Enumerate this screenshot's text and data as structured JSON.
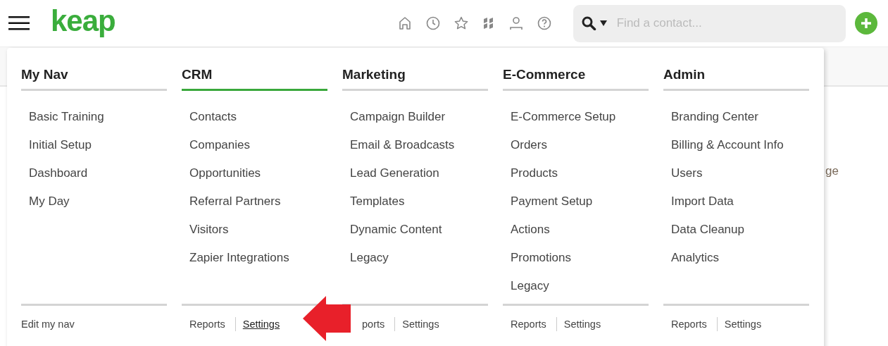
{
  "header": {
    "logo": "keap",
    "search": {
      "placeholder": "Find a contact..."
    }
  },
  "menu": {
    "columns": [
      {
        "title": "My Nav",
        "selected": false,
        "items": [
          "Basic Training",
          "Initial Setup",
          "Dashboard",
          "My Day"
        ],
        "footer": [
          {
            "label": "Edit my nav",
            "underlined": false
          }
        ]
      },
      {
        "title": "CRM",
        "selected": true,
        "items": [
          "Contacts",
          "Companies",
          "Opportunities",
          "Referral Partners",
          "Visitors",
          "Zapier Integrations"
        ],
        "footer": [
          {
            "label": "Reports",
            "underlined": false
          },
          {
            "label": "Settings",
            "underlined": true
          }
        ]
      },
      {
        "title": "Marketing",
        "selected": false,
        "items": [
          "Campaign Builder",
          "Email & Broadcasts",
          "Lead Generation",
          "Templates",
          "Dynamic Content",
          "Legacy"
        ],
        "footer": [
          {
            "label": "ports",
            "underlined": false
          },
          {
            "label": "Settings",
            "underlined": false
          }
        ]
      },
      {
        "title": "E-Commerce",
        "selected": false,
        "items": [
          "E-Commerce Setup",
          "Orders",
          "Products",
          "Payment Setup",
          "Actions",
          "Promotions",
          "Legacy"
        ],
        "footer": [
          {
            "label": "Reports",
            "underlined": false
          },
          {
            "label": "Settings",
            "underlined": false
          }
        ]
      },
      {
        "title": "Admin",
        "selected": false,
        "items": [
          "Branding Center",
          "Billing & Account Info",
          "Users",
          "Import Data",
          "Data Cleanup",
          "Analytics"
        ],
        "footer": [
          {
            "label": "Reports",
            "underlined": false
          },
          {
            "label": "Settings",
            "underlined": false
          }
        ]
      }
    ]
  },
  "background": {
    "text": "ge"
  }
}
